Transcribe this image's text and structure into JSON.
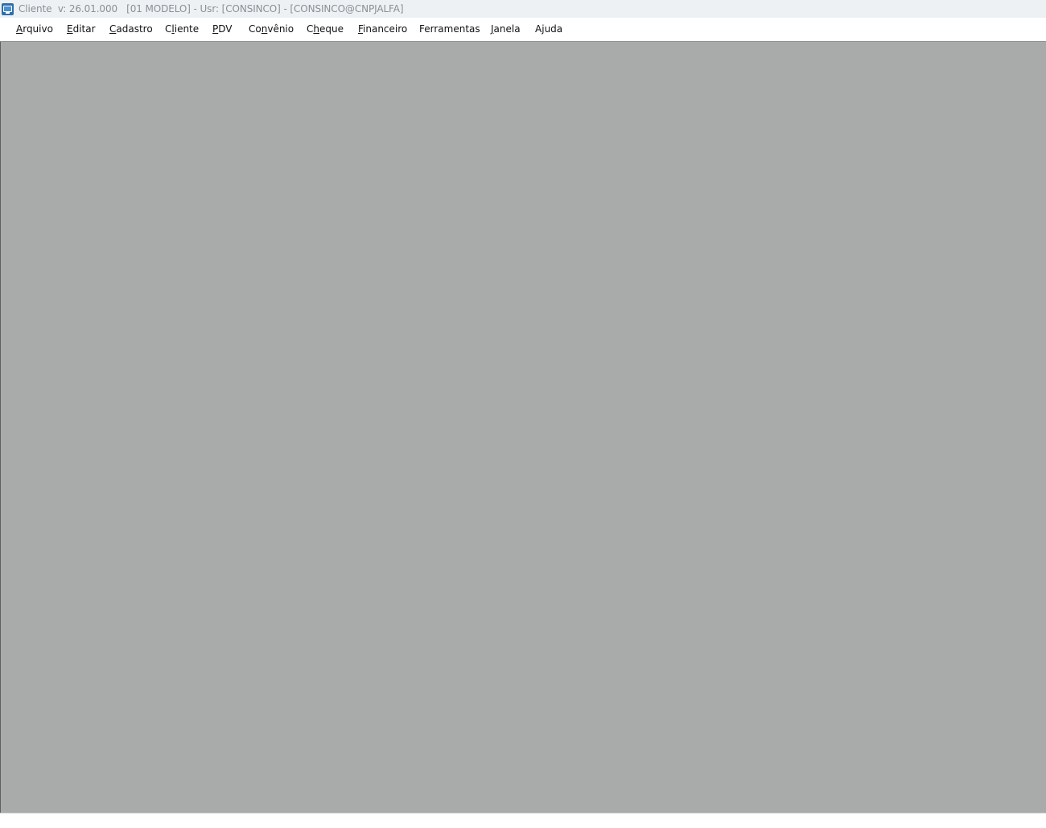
{
  "window": {
    "title": "Cliente  v: 26.01.000   [01 MODELO] - Usr: [CONSINCO] - [CONSINCO@CNPJALFA]",
    "icon": "app-icon"
  },
  "menu": {
    "items": [
      {
        "label": "Arquivo",
        "mnemonic_index": 0
      },
      {
        "label": "Editar",
        "mnemonic_index": 0
      },
      {
        "label": "Cadastro",
        "mnemonic_index": 0
      },
      {
        "label": "Cliente",
        "mnemonic_index": 1
      },
      {
        "label": "PDV",
        "mnemonic_index": 0
      },
      {
        "label": "Convênio",
        "mnemonic_index": 2
      },
      {
        "label": "Cheque",
        "mnemonic_index": 1
      },
      {
        "label": "Financeiro",
        "mnemonic_index": 0
      },
      {
        "label": "Ferramentas",
        "mnemonic_index": -1
      },
      {
        "label": "Janela",
        "mnemonic_index": 0
      },
      {
        "label": "Ajuda",
        "mnemonic_index": 1
      }
    ]
  },
  "colors": {
    "titlebar_bg": "#eef1f4",
    "workspace_bg": "#a9abaa",
    "title_text": "#8a8f94"
  }
}
